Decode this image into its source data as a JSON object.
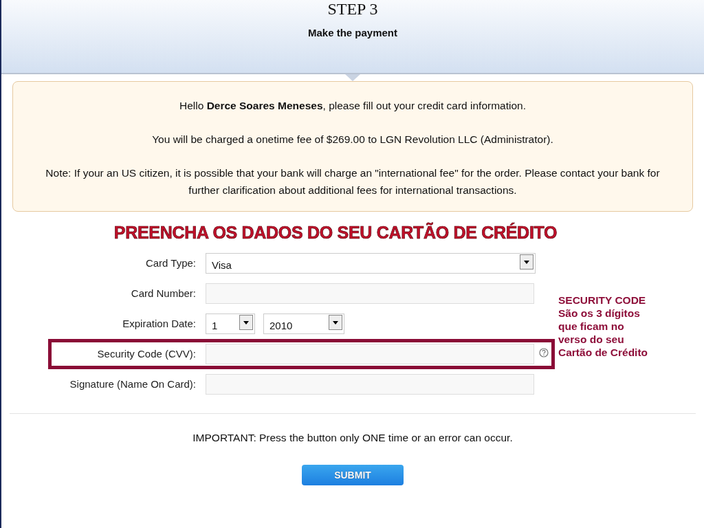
{
  "header": {
    "step": "STEP 3",
    "subtitle": "Make the payment"
  },
  "notice": [
    "Hello **Derce Soares Meneses**, please fill out your credit card information.",
    "You will be charged a onetime fee of $269.00 to LGN Revolution LLC (Administrator).",
    "Note: If your an US citizen, it is possible that your bank will charge an \"international fee\" for the order. Please contact your bank for further clarification about additional fees for international transactions."
  ],
  "heading": "PREENCHA OS DADOS DO SEU CARTÃO DE CRÉDITO",
  "fields": [
    {
      "kind": "select",
      "label": "Card Type:",
      "value": "Visa",
      "highlighted": false
    },
    {
      "kind": "text",
      "label": "Card Number:",
      "highlighted": false
    },
    {
      "kind": "date",
      "label": "Expiration Date:",
      "month": "1",
      "year": "2010",
      "highlighted": false
    },
    {
      "kind": "help",
      "label": "Security Code (CVV):",
      "highlighted": true
    },
    {
      "kind": "text",
      "label": "Signature (Name On Card):",
      "highlighted": false
    }
  ],
  "side_note": [
    "SECURITY CODE",
    "São os 3 dígitos",
    "que ficam no",
    "verso do seu",
    "Cartão de Crédito"
  ],
  "important": "IMPORTANT: Press the button only ONE time or an error can occur.",
  "submit": "SUBMIT"
}
